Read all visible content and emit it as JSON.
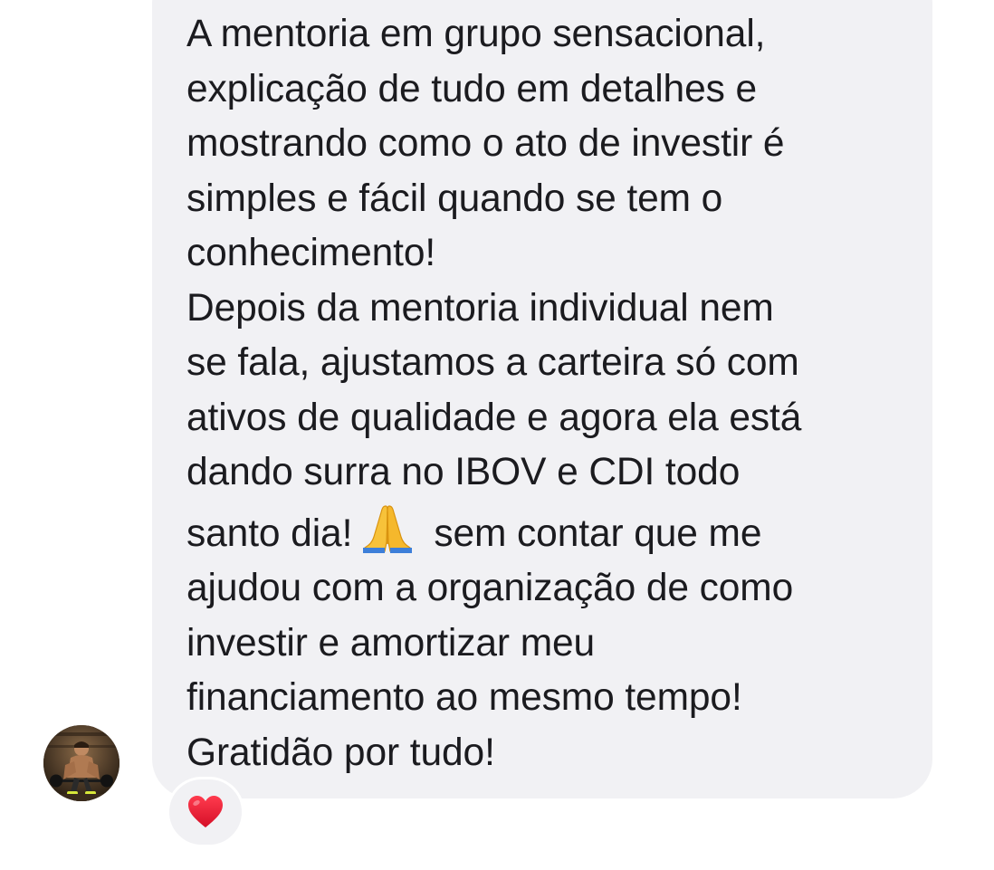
{
  "message": {
    "paragraph_1": [
      "A mentoria em grupo sensacional,",
      "explicação de tudo em detalhes e",
      "mostrando como o ato de investir é",
      "simples e fácil quando se tem o",
      "conhecimento!"
    ],
    "paragraph_2": {
      "line_1": "Depois da mentoria individual nem",
      "line_2": "se fala, ajustamos a carteira só com",
      "line_3": "ativos de qualidade e agora ela está",
      "line_4": "dando surra no IBOV e CDI todo",
      "line_5_before_emoji": "santo dia!",
      "line_5_after_emoji": "sem contar que me",
      "line_6": "ajudou com a organização de como",
      "line_7": "investir e amortizar meu",
      "line_8": "financiamento ao mesmo tempo!",
      "line_9": "Gratidão por tudo!"
    },
    "inline_emoji": "praying-hands-icon"
  },
  "reaction": {
    "icon": "heart-icon",
    "color": "#e8112d"
  },
  "avatar": {
    "icon": "profile-photo-icon"
  },
  "colors": {
    "bubble_background": "#f1f1f4",
    "text": "#1b1b1f",
    "page_background": "#ffffff"
  }
}
